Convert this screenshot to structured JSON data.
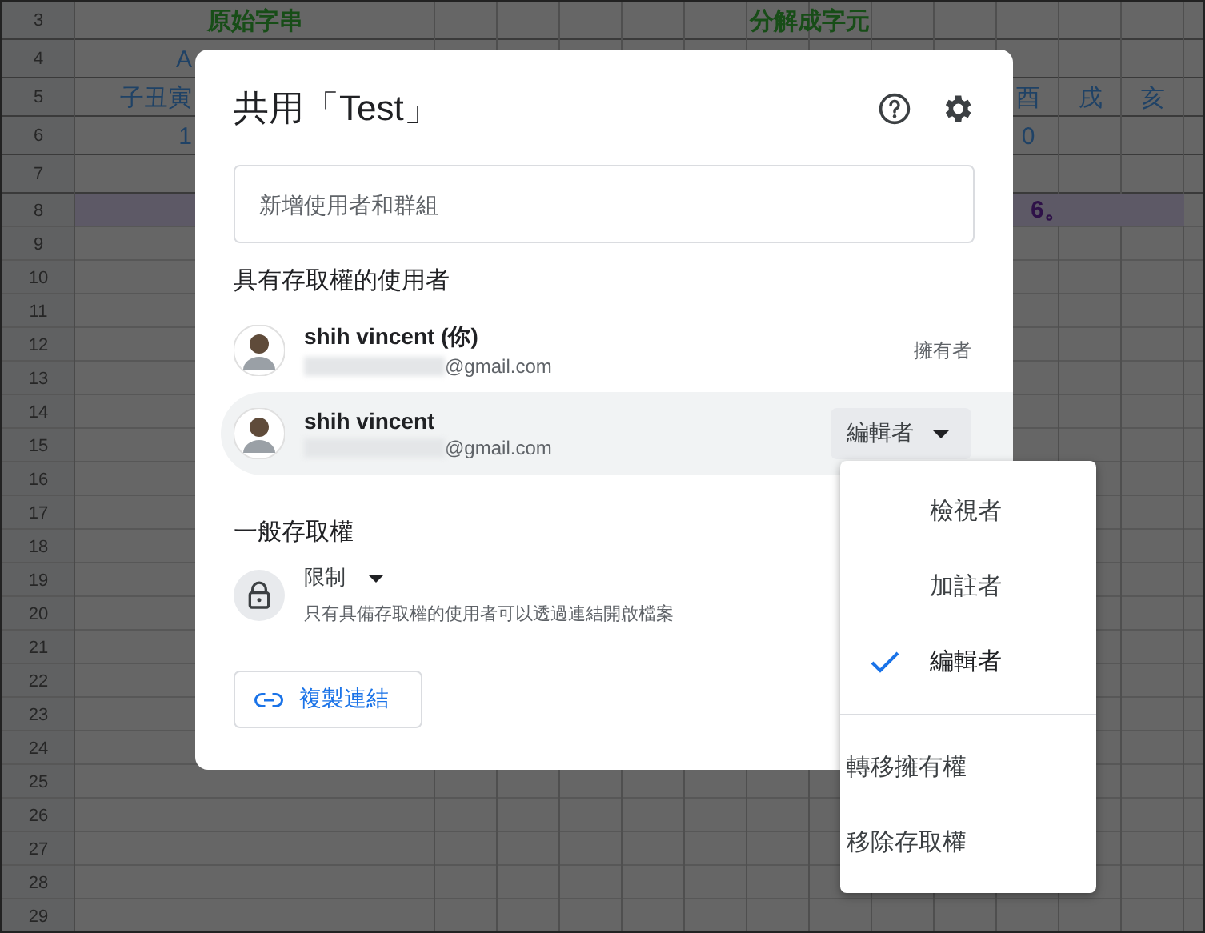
{
  "sheet": {
    "rows": [
      {
        "number": "3",
        "kind": "header",
        "cells": [
          "原始字串",
          "分解成字元"
        ]
      },
      {
        "number": "4",
        "kind": "data",
        "cells": [
          "A"
        ]
      },
      {
        "number": "5",
        "kind": "data",
        "cells": [
          "子丑寅",
          "",
          "",
          "",
          "",
          "",
          "",
          "",
          "",
          "",
          "酉",
          "戌",
          "亥"
        ]
      },
      {
        "number": "6",
        "kind": "data",
        "cells": [
          "1",
          "",
          "",
          "",
          "",
          "",
          "",
          "",
          "",
          "",
          "0"
        ]
      },
      {
        "number": "7",
        "kind": "data",
        "cells": []
      },
      {
        "number": "8",
        "kind": "note",
        "cells": [
          "",
          "",
          "",
          "",
          "",
          "",
          "",
          "",
          "",
          "",
          "6。"
        ]
      },
      {
        "number": "9",
        "kind": "data",
        "cells": []
      },
      {
        "number": "10",
        "kind": "data",
        "cells": []
      },
      {
        "number": "11",
        "kind": "data",
        "cells": []
      },
      {
        "number": "12",
        "kind": "data",
        "cells": []
      },
      {
        "number": "13",
        "kind": "data",
        "cells": []
      },
      {
        "number": "14",
        "kind": "data",
        "cells": []
      },
      {
        "number": "15",
        "kind": "data",
        "cells": []
      },
      {
        "number": "16",
        "kind": "data",
        "cells": []
      },
      {
        "number": "17",
        "kind": "data",
        "cells": []
      },
      {
        "number": "18",
        "kind": "data",
        "cells": []
      },
      {
        "number": "19",
        "kind": "data",
        "cells": []
      },
      {
        "number": "20",
        "kind": "data",
        "cells": []
      },
      {
        "number": "21",
        "kind": "data",
        "cells": []
      },
      {
        "number": "22",
        "kind": "data",
        "cells": []
      },
      {
        "number": "23",
        "kind": "data",
        "cells": []
      },
      {
        "number": "24",
        "kind": "data",
        "cells": []
      },
      {
        "number": "25",
        "kind": "data",
        "cells": []
      },
      {
        "number": "26",
        "kind": "data",
        "cells": []
      },
      {
        "number": "27",
        "kind": "data",
        "cells": []
      },
      {
        "number": "28",
        "kind": "data",
        "cells": []
      },
      {
        "number": "29",
        "kind": "data",
        "cells": []
      }
    ]
  },
  "dialog": {
    "title": "共用「Test」",
    "add_field": {
      "placeholder": "新增使用者和群組"
    },
    "people_heading": "具有存取權的使用者",
    "people": [
      {
        "name": "shih vincent (你)",
        "email": "@gmail.com",
        "role": "擁有者",
        "kind": "owner",
        "selected": false
      },
      {
        "name": "shih vincent",
        "email": "@gmail.com",
        "role": "編輯者",
        "kind": "dropdown",
        "selected": true
      }
    ],
    "general_heading": "一般存取權",
    "general_access": {
      "value": "限制",
      "description": "只有具備存取權的使用者可以透過連結開啟檔案"
    },
    "copy_link": "複製連結"
  },
  "role_menu": {
    "roles": [
      {
        "label": "檢視者",
        "selected": false
      },
      {
        "label": "加註者",
        "selected": false
      },
      {
        "label": "編輯者",
        "selected": true
      }
    ],
    "actions": [
      "轉移擁有權",
      "移除存取權"
    ]
  }
}
